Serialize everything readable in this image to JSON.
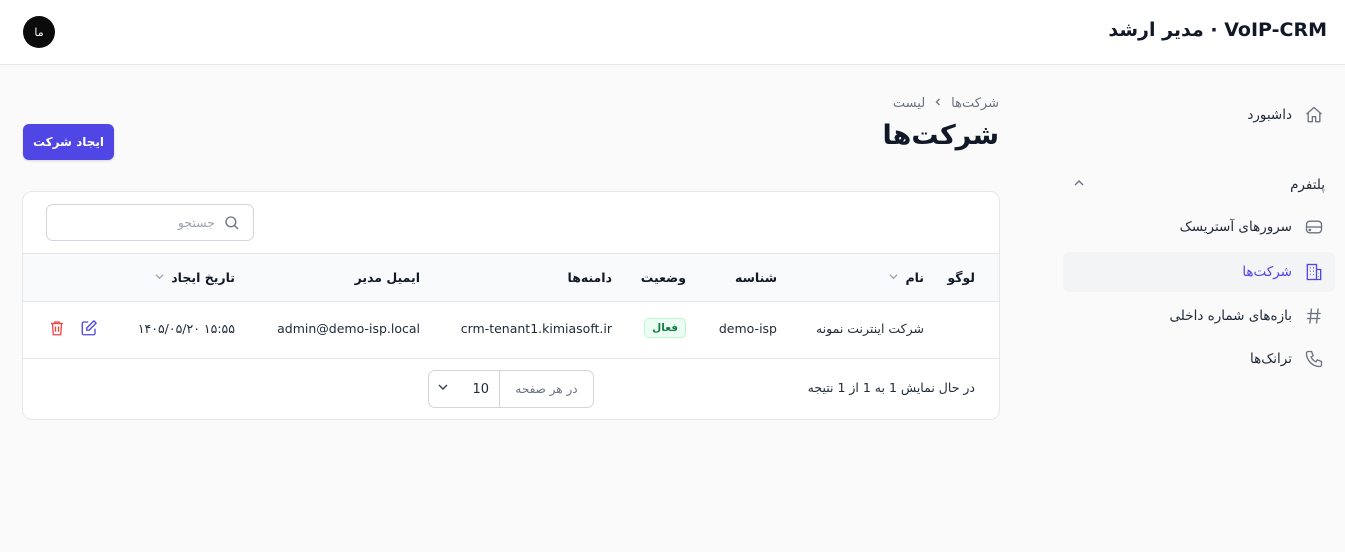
{
  "header": {
    "title": "VoIP-CRM · مدیر ارشد",
    "avatar_text": "ما"
  },
  "sidebar": {
    "items": [
      {
        "label": "داشبورد",
        "icon": "home-icon"
      },
      {
        "label": "سرورهای آستریسک",
        "icon": "server-icon"
      },
      {
        "label": "شرکت‌ها",
        "icon": "building-icon",
        "active": true
      },
      {
        "label": "بازه‌های شماره داخلی",
        "icon": "hash-icon"
      },
      {
        "label": "ترانک‌ها",
        "icon": "phone-icon"
      }
    ],
    "section_label": "پلتفرم"
  },
  "breadcrumb": {
    "root": "شرکت‌ها",
    "current": "لیست"
  },
  "page": {
    "title": "شرکت‌ها",
    "create_button": "ایجاد شرکت"
  },
  "search": {
    "placeholder": "جستجو"
  },
  "table": {
    "headers": {
      "logo": "لوگو",
      "name": "نام",
      "slug": "شناسه",
      "status": "وضعیت",
      "domains": "دامنه‌ها",
      "admin_email": "ایمیل مدیر",
      "created_at": "تاریخ ایجاد"
    },
    "rows": [
      {
        "name": "شرکت اینترنت نمونه",
        "slug": "demo-isp",
        "status": "فعال",
        "domain": "crm-tenant1.kimiasoft.ir",
        "admin_email": "admin@demo-isp.local",
        "created_at": "۱۴۰۵/۰۵/۲۰ ۱۵:۵۵"
      }
    ]
  },
  "pagination": {
    "summary": "در حال نمایش 1 به 1 از 1 نتیجه",
    "per_page_label": "در هر صفحه",
    "per_page_value": "10"
  },
  "colors": {
    "accent": "#4f46e5",
    "danger": "#ef4444",
    "success_bg": "#ecfdf3",
    "success_text": "#15803d"
  }
}
